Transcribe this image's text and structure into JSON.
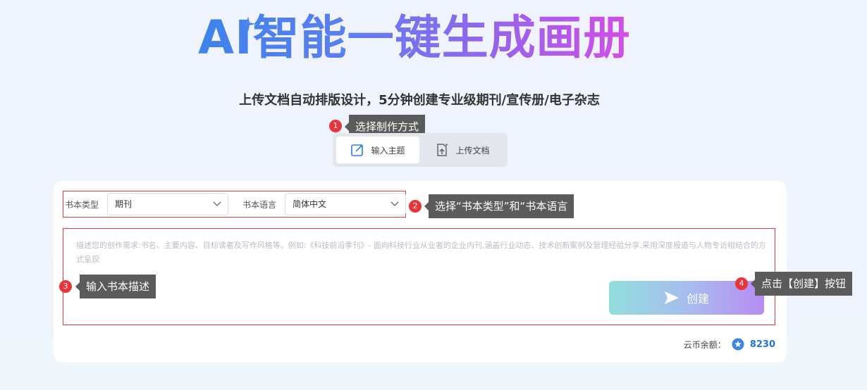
{
  "hero": {
    "title": "AI智能一键生成画册"
  },
  "subtitle": "上传文档自动排版设计，5分钟创建专业级期刊/宣传册/电子杂志",
  "mode_switch": {
    "tabs": [
      {
        "label": "输入主题",
        "icon": "edit-icon",
        "active": true
      },
      {
        "label": "上传文档",
        "icon": "upload-doc-icon",
        "active": false
      }
    ]
  },
  "form": {
    "book_type": {
      "label": "书本类型",
      "value": "期刊"
    },
    "book_language": {
      "label": "书本语言",
      "value": "简体中文"
    },
    "description_placeholder": "描述您的创作需求:书名、主要内容、目标读者及写作风格等。例如:《科技前沿季刊》- 面向科技行业从业者的企业内刊,涵盖行业动态、技术创新案例及管理经验分享,采用深度报道与人物专访相结合的方式呈现",
    "create_label": "创建"
  },
  "balance": {
    "label": "云币余额：",
    "amount": "8230"
  },
  "annotations": [
    {
      "number": "1",
      "text": "选择制作方式"
    },
    {
      "number": "2",
      "text": "选择“书本类型”和“书本语言"
    },
    {
      "number": "3",
      "text": "输入书本描述"
    },
    {
      "number": "4",
      "text": "点击【创建】按钮"
    }
  ],
  "colors": {
    "accent_blue": "#3d83ec",
    "accent_purple": "#d24ee6",
    "annotation_red": "#e9353a",
    "balance_blue": "#1f77d4"
  }
}
